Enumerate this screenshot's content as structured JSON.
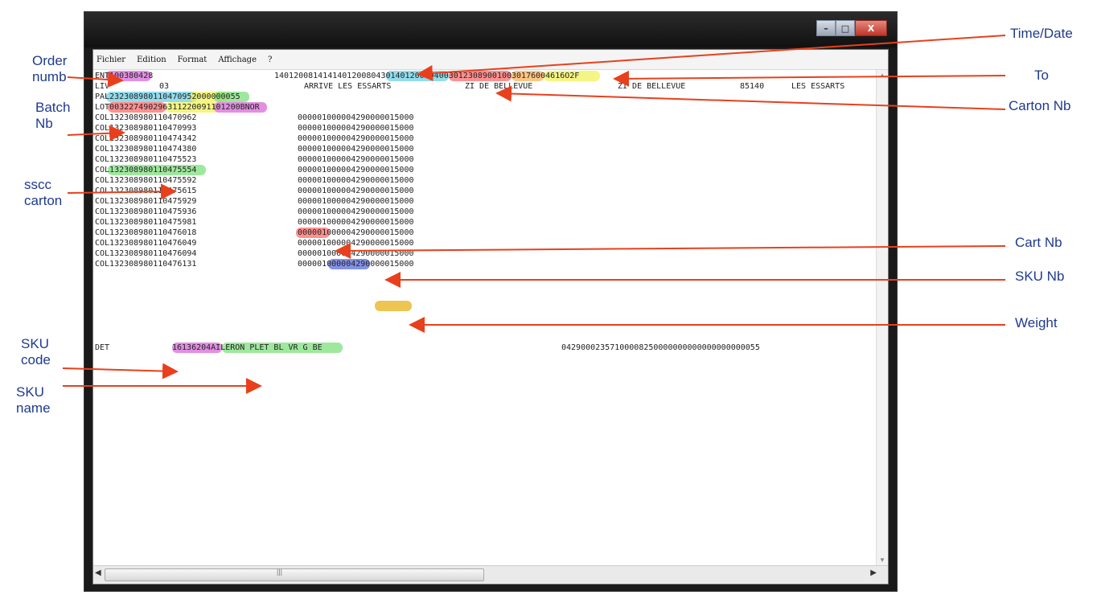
{
  "window": {
    "buttons": {
      "minimize": "–",
      "maximize": "□",
      "close": "X"
    },
    "menu": [
      "Fichier",
      "Edition",
      "Format",
      "Affichage",
      "?"
    ]
  },
  "editor": {
    "header": {
      "ent": "ENT100380428",
      "ent_right": "140120081414140120080430140120080400301230890010030176004616O2F",
      "liv_left": "LIV",
      "liv_code": "03",
      "liv_dest": "ARRIVE LES ESSARTS",
      "liv_zi1": "ZI DE BELLEVUE",
      "liv_zi2": "ZI DE BELLEVUE",
      "liv_cp": "85140",
      "liv_city": "LES ESSARTS",
      "pal": "PAL232308980110470952000000055",
      "lot": "LOT003227490296311220091101200BNOR"
    },
    "col_rows": [
      {
        "code": "COL132308980110470962",
        "value": "000001000004290000015000"
      },
      {
        "code": "COL132308980110470993",
        "value": "000001000004290000015000"
      },
      {
        "code": "COL132308980110474342",
        "value": "000001000004290000015000"
      },
      {
        "code": "COL132308980110474380",
        "value": "000001000004290000015000"
      },
      {
        "code": "COL132308980110475523",
        "value": "000001000004290000015000"
      },
      {
        "code": "COL132308980110475554",
        "value": "000001000004290000015000"
      },
      {
        "code": "COL132308980110475592",
        "value": "000001000004290000015000"
      },
      {
        "code": "COL132308980110475615",
        "value": "000001000004290000015000"
      },
      {
        "code": "COL132308980110475929",
        "value": "000001000004290000015000"
      },
      {
        "code": "COL132308980110475936",
        "value": "000001000004290000015000"
      },
      {
        "code": "COL132308980110475981",
        "value": "000001000004290000015000"
      },
      {
        "code": "COL132308980110476018",
        "value": "000001000004290000015000"
      },
      {
        "code": "COL132308980110476049",
        "value": "000001000004290000015000"
      },
      {
        "code": "COL132308980110476094",
        "value": "000001000004290000015000"
      },
      {
        "code": "COL132308980110476131",
        "value": "000001000004290000015000"
      }
    ],
    "det": {
      "prefix": "DET",
      "text": "16136204AILERON PLET BL VR G BE",
      "right": "04290002357100008250000000000000000000055"
    }
  },
  "annotations": {
    "left": {
      "order_numb": "Order\nnumb",
      "batch_nb": "Batch\nNb",
      "sscc_carton": "sscc\ncarton",
      "sku_code": "SKU\ncode",
      "sku_name": "SKU\nname"
    },
    "right": {
      "time_date": "Time/Date",
      "to": "To",
      "carton_nb": "Carton Nb",
      "cart_nb": "Cart Nb",
      "sku_nb": "SKU Nb",
      "weight": "Weight"
    }
  },
  "colors": {
    "annotation_text": "#1f3a8f",
    "arrow": "#e8401c"
  }
}
